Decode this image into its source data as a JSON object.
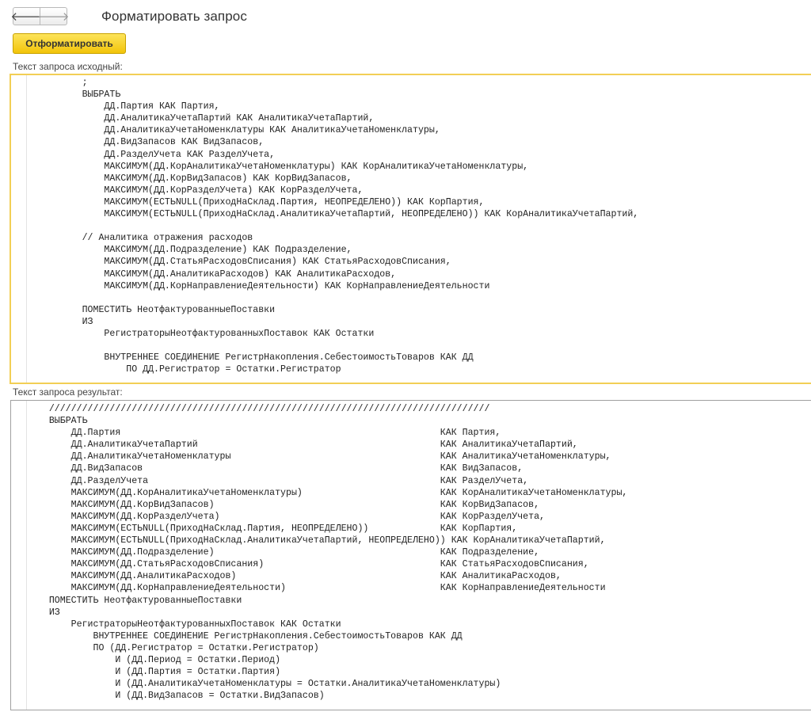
{
  "toolbar": {
    "back_icon": "arrow-left-icon",
    "forward_icon": "arrow-right-icon",
    "back_glyph": "🡐",
    "forward_glyph": "🡒"
  },
  "page_title": "Форматировать запрос",
  "format_button": "Отформатировать",
  "source": {
    "label": "Текст запроса исходный:",
    "lines": [
      "          ;",
      "          ВЫБРАТЬ",
      "              ДД.Партия КАК Партия,",
      "              ДД.АналитикаУчетаПартий КАК АналитикаУчетаПартий,",
      "              ДД.АналитикаУчетаНоменклатуры КАК АналитикаУчетаНоменклатуры,",
      "              ДД.ВидЗапасов КАК ВидЗапасов,",
      "              ДД.РазделУчета КАК РазделУчета,",
      "              МАКСИМУМ(ДД.КорАналитикаУчетаНоменклатуры) КАК КорАналитикаУчетаНоменклатуры,",
      "              МАКСИМУМ(ДД.КорВидЗапасов) КАК КорВидЗапасов,",
      "              МАКСИМУМ(ДД.КорРазделУчета) КАК КорРазделУчета,",
      "              МАКСИМУМ(ЕСТЬNULL(ПриходНаСклад.Партия, НЕОПРЕДЕЛЕНО)) КАК КорПартия,",
      "              МАКСИМУМ(ЕСТЬNULL(ПриходНаСклад.АналитикаУчетаПартий, НЕОПРЕДЕЛЕНО)) КАК КорАналитикаУчетаПартий,",
      "",
      "          // Аналитика отражения расходов",
      "              МАКСИМУМ(ДД.Подразделение) КАК Подразделение,",
      "              МАКСИМУМ(ДД.СтатьяРасходовСписания) КАК СтатьяРасходовСписания,",
      "              МАКСИМУМ(ДД.АналитикаРасходов) КАК АналитикаРасходов,",
      "              МАКСИМУМ(ДД.КорНаправлениеДеятельности) КАК КорНаправлениеДеятельности",
      "",
      "          ПОМЕСТИТЬ НеотфактурованныеПоставки",
      "          ИЗ",
      "              РегистраторыНеотфактурованныхПоставок КАК Остатки",
      "",
      "              ВНУТРЕННЕЕ СОЕДИНЕНИЕ РегистрНакопления.СебестоимостьТоваров КАК ДД",
      "                  ПО ДД.Регистратор = Остатки.Регистратор"
    ]
  },
  "result": {
    "label": "Текст запроса результат:",
    "lines": [
      "    ////////////////////////////////////////////////////////////////////////////////",
      "    ВЫБРАТЬ",
      "        ДД.Партия                                                          КАК Партия,",
      "        ДД.АналитикаУчетаПартий                                            КАК АналитикаУчетаПартий,",
      "        ДД.АналитикаУчетаНоменклатуры                                      КАК АналитикаУчетаНоменклатуры,",
      "        ДД.ВидЗапасов                                                      КАК ВидЗапасов,",
      "        ДД.РазделУчета                                                     КАК РазделУчета,",
      "        МАКСИМУМ(ДД.КорАналитикаУчетаНоменклатуры)                         КАК КорАналитикаУчетаНоменклатуры,",
      "        МАКСИМУМ(ДД.КорВидЗапасов)                                         КАК КорВидЗапасов,",
      "        МАКСИМУМ(ДД.КорРазделУчета)                                        КАК КорРазделУчета,",
      "        МАКСИМУМ(ЕСТЬNULL(ПриходНаСклад.Партия, НЕОПРЕДЕЛЕНО))             КАК КорПартия,",
      "        МАКСИМУМ(ЕСТЬNULL(ПриходНаСклад.АналитикаУчетаПартий, НЕОПРЕДЕЛЕНО)) КАК КорАналитикаУчетаПартий,",
      "        МАКСИМУМ(ДД.Подразделение)                                         КАК Подразделение,",
      "        МАКСИМУМ(ДД.СтатьяРасходовСписания)                                КАК СтатьяРасходовСписания,",
      "        МАКСИМУМ(ДД.АналитикаРасходов)                                     КАК АналитикаРасходов,",
      "        МАКСИМУМ(ДД.КорНаправлениеДеятельности)                            КАК КорНаправлениеДеятельности",
      "    ПОМЕСТИТЬ НеотфактурованныеПоставки",
      "    ИЗ",
      "        РегистраторыНеотфактурованныхПоставок КАК Остатки",
      "            ВНУТРЕННЕЕ СОЕДИНЕНИЕ РегистрНакопления.СебестоимостьТоваров КАК ДД",
      "            ПО (ДД.Регистратор = Остатки.Регистратор)",
      "                И (ДД.Период = Остатки.Период)",
      "                И (ДД.Партия = Остатки.Партия)",
      "                И (ДД.АналитикаУчетаНоменклатуры = Остатки.АналитикаУчетаНоменклатуры)",
      "                И (ДД.ВидЗапасов = Остатки.ВидЗапасов)"
    ]
  }
}
